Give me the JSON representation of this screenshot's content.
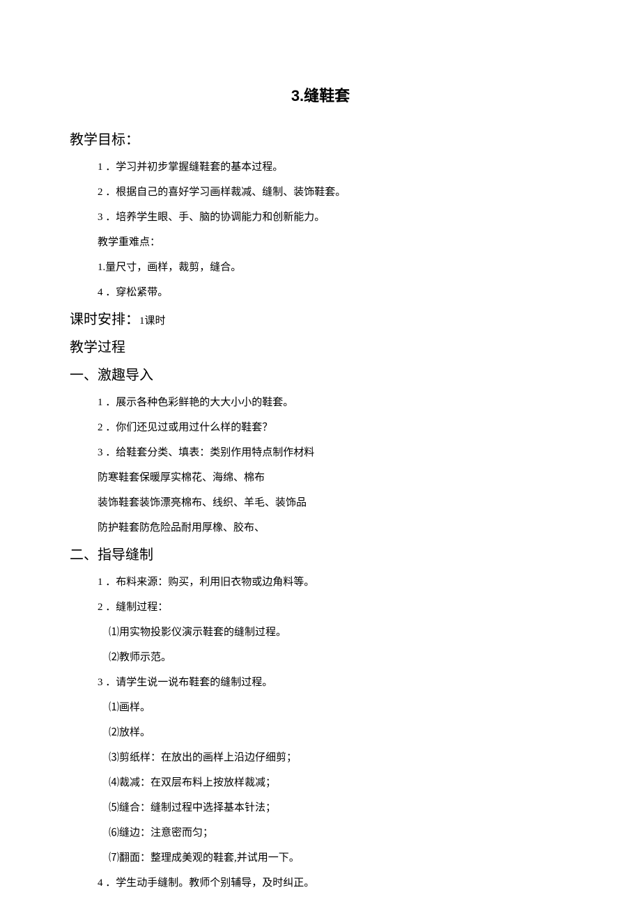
{
  "title": "3.缝鞋套",
  "section1": {
    "heading": "教学目标：",
    "items": [
      "1 ．学习并初步掌握缝鞋套的基本过程。",
      "2 ．根据自己的喜好学习画样裁减、缝制、装饰鞋套。",
      "3 ．培养学生眼、手、脑的协调能力和创新能力。",
      "教学重难点：",
      "1.量尺寸，画样，裁剪，缝合。",
      "4 ．穿松紧带。"
    ]
  },
  "section2": {
    "heading_main": "课时安排：",
    "heading_sub": "1课时"
  },
  "section3": {
    "heading": "教学过程"
  },
  "section4": {
    "heading": "一、激趣导入",
    "items": [
      "1 ．展示各种色彩鲜艳的大大小小的鞋套。",
      "2 ．你们还见过或用过什么样的鞋套？",
      "3 ．给鞋套分类、填表：类别作用特点制作材料",
      "防寒鞋套保暖厚实棉花、海绵、棉布",
      "装饰鞋套装饰漂亮棉布、线织、羊毛、装饰品",
      "防护鞋套防危险品耐用厚橡、胶布、"
    ]
  },
  "section5": {
    "heading": "二、指导缝制",
    "items": [
      "1 ．布料来源：购买，利用旧衣物或边角料等。",
      "2 ．缝制过程："
    ],
    "sub_items1": [
      "⑴用实物投影仪演示鞋套的缝制过程。",
      "⑵教师示范。"
    ],
    "item3": "3 ．请学生说一说布鞋套的缝制过程。",
    "sub_items2": [
      "⑴画样。",
      "⑵放样。",
      "⑶剪纸样：在放出的画样上沿边仔细剪；",
      "⑷裁减：在双层布料上按放样裁减；",
      "⑸缝合：缝制过程中选择基本针法；",
      "⑹缝边：注意密而匀；",
      "⑺翻面：整理成美观的鞋套,并试用一下。"
    ],
    "item4": "4 ．学生动手缝制。教师个别辅导，及时纠正。"
  }
}
